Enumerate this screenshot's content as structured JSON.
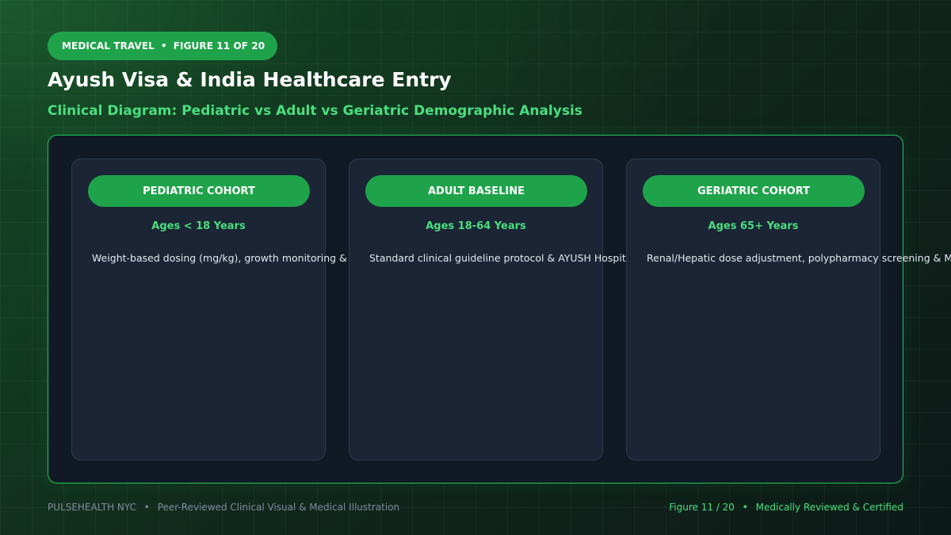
{
  "badge": {
    "category": "MEDICAL TRAVEL",
    "separator": "•",
    "figure": "FIGURE 11 OF 20"
  },
  "title": "Ayush Visa & India Healthcare Entry",
  "subtitle": "Clinical Diagram: Pediatric vs Adult vs Geriatric Demographic Analysis",
  "cohorts": [
    {
      "label": "PEDIATRIC COHORT",
      "age": "Ages < 18 Years",
      "description": "Weight-based dosing (mg/kg), growth monitoring & E-V"
    },
    {
      "label": "ADULT BASELINE",
      "age": "Ages 18-64 Years",
      "description": "Standard clinical guideline protocol & AYUSH Hospital V"
    },
    {
      "label": "GERIATRIC COHORT",
      "age": "Ages 65+ Years",
      "description": "Renal/Hepatic dose adjustment, polypharmacy screening & Medic"
    }
  ],
  "footer": {
    "brand": "PULSEHEALTH NYC",
    "separator": "•",
    "tagline": "Peer-Reviewed Clinical Visual & Medical Illustration",
    "figure": "Figure 11 / 20",
    "certification": "Medically Reviewed & Certified"
  },
  "colors": {
    "accent": "#1fa34a",
    "accent_text": "#4ade80",
    "panel_border": "#22c55e",
    "panel_bg": "#111a24",
    "card_bg": "#1b2535"
  }
}
